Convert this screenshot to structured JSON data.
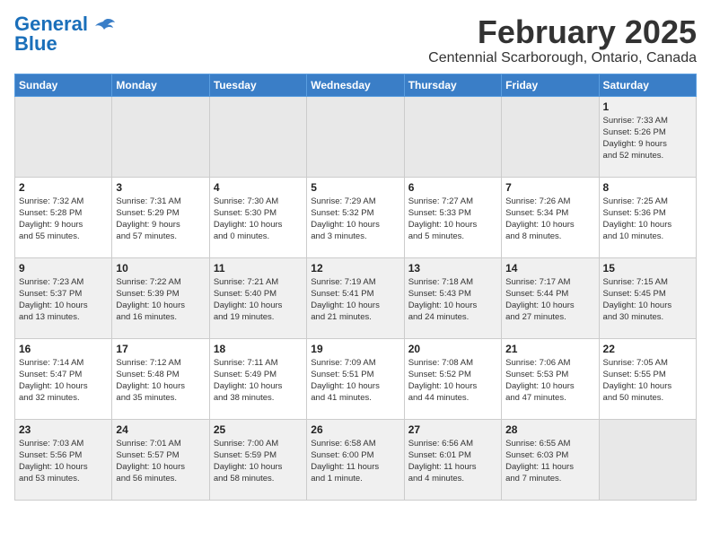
{
  "header": {
    "logo_line1": "General",
    "logo_line2": "Blue",
    "month_title": "February 2025",
    "location": "Centennial Scarborough, Ontario, Canada"
  },
  "weekdays": [
    "Sunday",
    "Monday",
    "Tuesday",
    "Wednesday",
    "Thursday",
    "Friday",
    "Saturday"
  ],
  "weeks": [
    [
      {
        "day": "",
        "info": ""
      },
      {
        "day": "",
        "info": ""
      },
      {
        "day": "",
        "info": ""
      },
      {
        "day": "",
        "info": ""
      },
      {
        "day": "",
        "info": ""
      },
      {
        "day": "",
        "info": ""
      },
      {
        "day": "1",
        "info": "Sunrise: 7:33 AM\nSunset: 5:26 PM\nDaylight: 9 hours\nand 52 minutes."
      }
    ],
    [
      {
        "day": "2",
        "info": "Sunrise: 7:32 AM\nSunset: 5:28 PM\nDaylight: 9 hours\nand 55 minutes."
      },
      {
        "day": "3",
        "info": "Sunrise: 7:31 AM\nSunset: 5:29 PM\nDaylight: 9 hours\nand 57 minutes."
      },
      {
        "day": "4",
        "info": "Sunrise: 7:30 AM\nSunset: 5:30 PM\nDaylight: 10 hours\nand 0 minutes."
      },
      {
        "day": "5",
        "info": "Sunrise: 7:29 AM\nSunset: 5:32 PM\nDaylight: 10 hours\nand 3 minutes."
      },
      {
        "day": "6",
        "info": "Sunrise: 7:27 AM\nSunset: 5:33 PM\nDaylight: 10 hours\nand 5 minutes."
      },
      {
        "day": "7",
        "info": "Sunrise: 7:26 AM\nSunset: 5:34 PM\nDaylight: 10 hours\nand 8 minutes."
      },
      {
        "day": "8",
        "info": "Sunrise: 7:25 AM\nSunset: 5:36 PM\nDaylight: 10 hours\nand 10 minutes."
      }
    ],
    [
      {
        "day": "9",
        "info": "Sunrise: 7:23 AM\nSunset: 5:37 PM\nDaylight: 10 hours\nand 13 minutes."
      },
      {
        "day": "10",
        "info": "Sunrise: 7:22 AM\nSunset: 5:39 PM\nDaylight: 10 hours\nand 16 minutes."
      },
      {
        "day": "11",
        "info": "Sunrise: 7:21 AM\nSunset: 5:40 PM\nDaylight: 10 hours\nand 19 minutes."
      },
      {
        "day": "12",
        "info": "Sunrise: 7:19 AM\nSunset: 5:41 PM\nDaylight: 10 hours\nand 21 minutes."
      },
      {
        "day": "13",
        "info": "Sunrise: 7:18 AM\nSunset: 5:43 PM\nDaylight: 10 hours\nand 24 minutes."
      },
      {
        "day": "14",
        "info": "Sunrise: 7:17 AM\nSunset: 5:44 PM\nDaylight: 10 hours\nand 27 minutes."
      },
      {
        "day": "15",
        "info": "Sunrise: 7:15 AM\nSunset: 5:45 PM\nDaylight: 10 hours\nand 30 minutes."
      }
    ],
    [
      {
        "day": "16",
        "info": "Sunrise: 7:14 AM\nSunset: 5:47 PM\nDaylight: 10 hours\nand 32 minutes."
      },
      {
        "day": "17",
        "info": "Sunrise: 7:12 AM\nSunset: 5:48 PM\nDaylight: 10 hours\nand 35 minutes."
      },
      {
        "day": "18",
        "info": "Sunrise: 7:11 AM\nSunset: 5:49 PM\nDaylight: 10 hours\nand 38 minutes."
      },
      {
        "day": "19",
        "info": "Sunrise: 7:09 AM\nSunset: 5:51 PM\nDaylight: 10 hours\nand 41 minutes."
      },
      {
        "day": "20",
        "info": "Sunrise: 7:08 AM\nSunset: 5:52 PM\nDaylight: 10 hours\nand 44 minutes."
      },
      {
        "day": "21",
        "info": "Sunrise: 7:06 AM\nSunset: 5:53 PM\nDaylight: 10 hours\nand 47 minutes."
      },
      {
        "day": "22",
        "info": "Sunrise: 7:05 AM\nSunset: 5:55 PM\nDaylight: 10 hours\nand 50 minutes."
      }
    ],
    [
      {
        "day": "23",
        "info": "Sunrise: 7:03 AM\nSunset: 5:56 PM\nDaylight: 10 hours\nand 53 minutes."
      },
      {
        "day": "24",
        "info": "Sunrise: 7:01 AM\nSunset: 5:57 PM\nDaylight: 10 hours\nand 56 minutes."
      },
      {
        "day": "25",
        "info": "Sunrise: 7:00 AM\nSunset: 5:59 PM\nDaylight: 10 hours\nand 58 minutes."
      },
      {
        "day": "26",
        "info": "Sunrise: 6:58 AM\nSunset: 6:00 PM\nDaylight: 11 hours\nand 1 minute."
      },
      {
        "day": "27",
        "info": "Sunrise: 6:56 AM\nSunset: 6:01 PM\nDaylight: 11 hours\nand 4 minutes."
      },
      {
        "day": "28",
        "info": "Sunrise: 6:55 AM\nSunset: 6:03 PM\nDaylight: 11 hours\nand 7 minutes."
      },
      {
        "day": "",
        "info": ""
      }
    ]
  ]
}
